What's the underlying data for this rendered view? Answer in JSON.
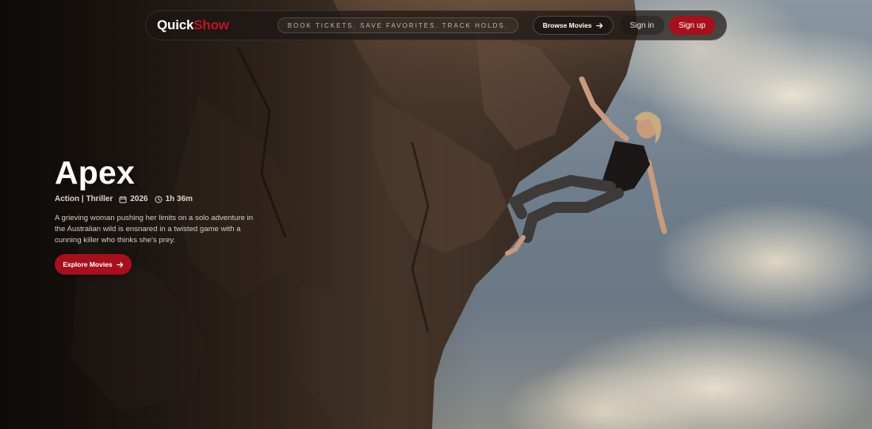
{
  "navbar": {
    "logo_primary": "Quick",
    "logo_accent": "Show",
    "tagline": "BOOK TICKETS. SAVE FAVORITES. TRACK HOLDS.",
    "browse_label": "Browse Movies",
    "signin_label": "Sign in",
    "signup_label": "Sign up"
  },
  "hero": {
    "title": "Apex",
    "genres": "Action | Thriller",
    "year": "2026",
    "duration": "1h 36m",
    "description": "A grieving woman pushing her limits on a solo adventure in the Australian wild is ensnared in a twisted game with a cunning killer who thinks she's prey.",
    "cta_label": "Explore Movies"
  },
  "icons": {
    "browse": "arrow-right-icon",
    "year": "calendar-icon",
    "duration": "clock-icon",
    "cta": "arrow-right-icon"
  },
  "colors": {
    "accent": "#a80f1c",
    "logo_accent": "#c0121f"
  }
}
